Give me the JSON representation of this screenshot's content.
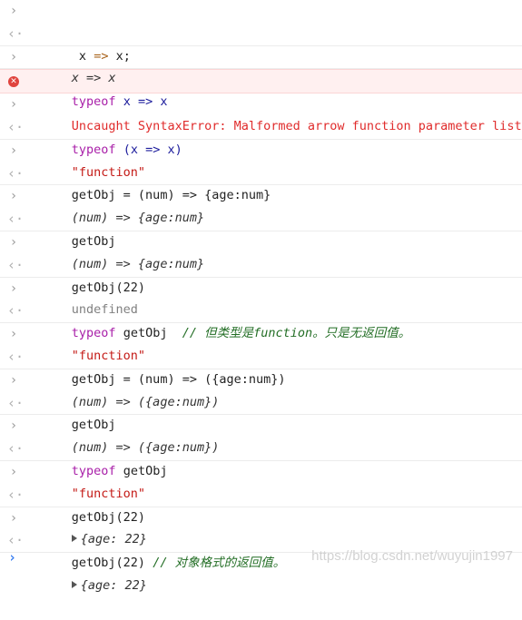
{
  "markers": {
    "prompt": ">",
    "result": "<·"
  },
  "entries": [
    {
      "input": {
        "text": " x => x;"
      },
      "output": {
        "text": "x => x"
      }
    },
    {
      "input": {
        "kw": "typeof",
        "rest": " x => x"
      }
    },
    {
      "error": {
        "text": "Uncaught SyntaxError: Malformed arrow function parameter list"
      }
    },
    {
      "input": {
        "kw": "typeof",
        "rest": " (x => x)"
      },
      "output": {
        "text": "\"function\""
      }
    },
    {
      "input": {
        "text": "getObj = (num) => {age:num}"
      },
      "output": {
        "text": "(num) => {age:num}"
      }
    },
    {
      "input": {
        "text": "getObj"
      },
      "output": {
        "text": "(num) => {age:num}"
      }
    },
    {
      "input": {
        "text": "getObj(22)"
      },
      "output": {
        "text": "undefined"
      }
    },
    {
      "input": {
        "kw": "typeof",
        "rest": " getObj  ",
        "comment": "// 但类型是function。只是无返回值。"
      },
      "output": {
        "text": "\"function\""
      }
    },
    {
      "input": {
        "text": "getObj = (num) => ({age:num})"
      },
      "output": {
        "text": "(num) => ({age:num})"
      }
    },
    {
      "input": {
        "text": "getObj"
      },
      "output": {
        "text": "(num) => ({age:num})"
      }
    },
    {
      "input": {
        "kw": "typeof",
        "rest": " getObj"
      },
      "output": {
        "text": "\"function\""
      }
    },
    {
      "input": {
        "text": "getObj(22)"
      },
      "output": {
        "text": "{age: 22}"
      }
    },
    {
      "input": {
        "text": "getObj(22) ",
        "comment": "// 对象格式的返回值。"
      },
      "output": {
        "text": "{age: 22}"
      }
    }
  ],
  "final_prompt": ">",
  "watermark": "https://blog.csdn.net/wuyujin1997",
  "colors": {
    "error_bg": "#fff0f0",
    "error_text": "#e02c2c",
    "keyword": "#a81ea8",
    "string": "#c41a16",
    "comment": "#236e25",
    "prompt_blue": "#367cf1"
  }
}
